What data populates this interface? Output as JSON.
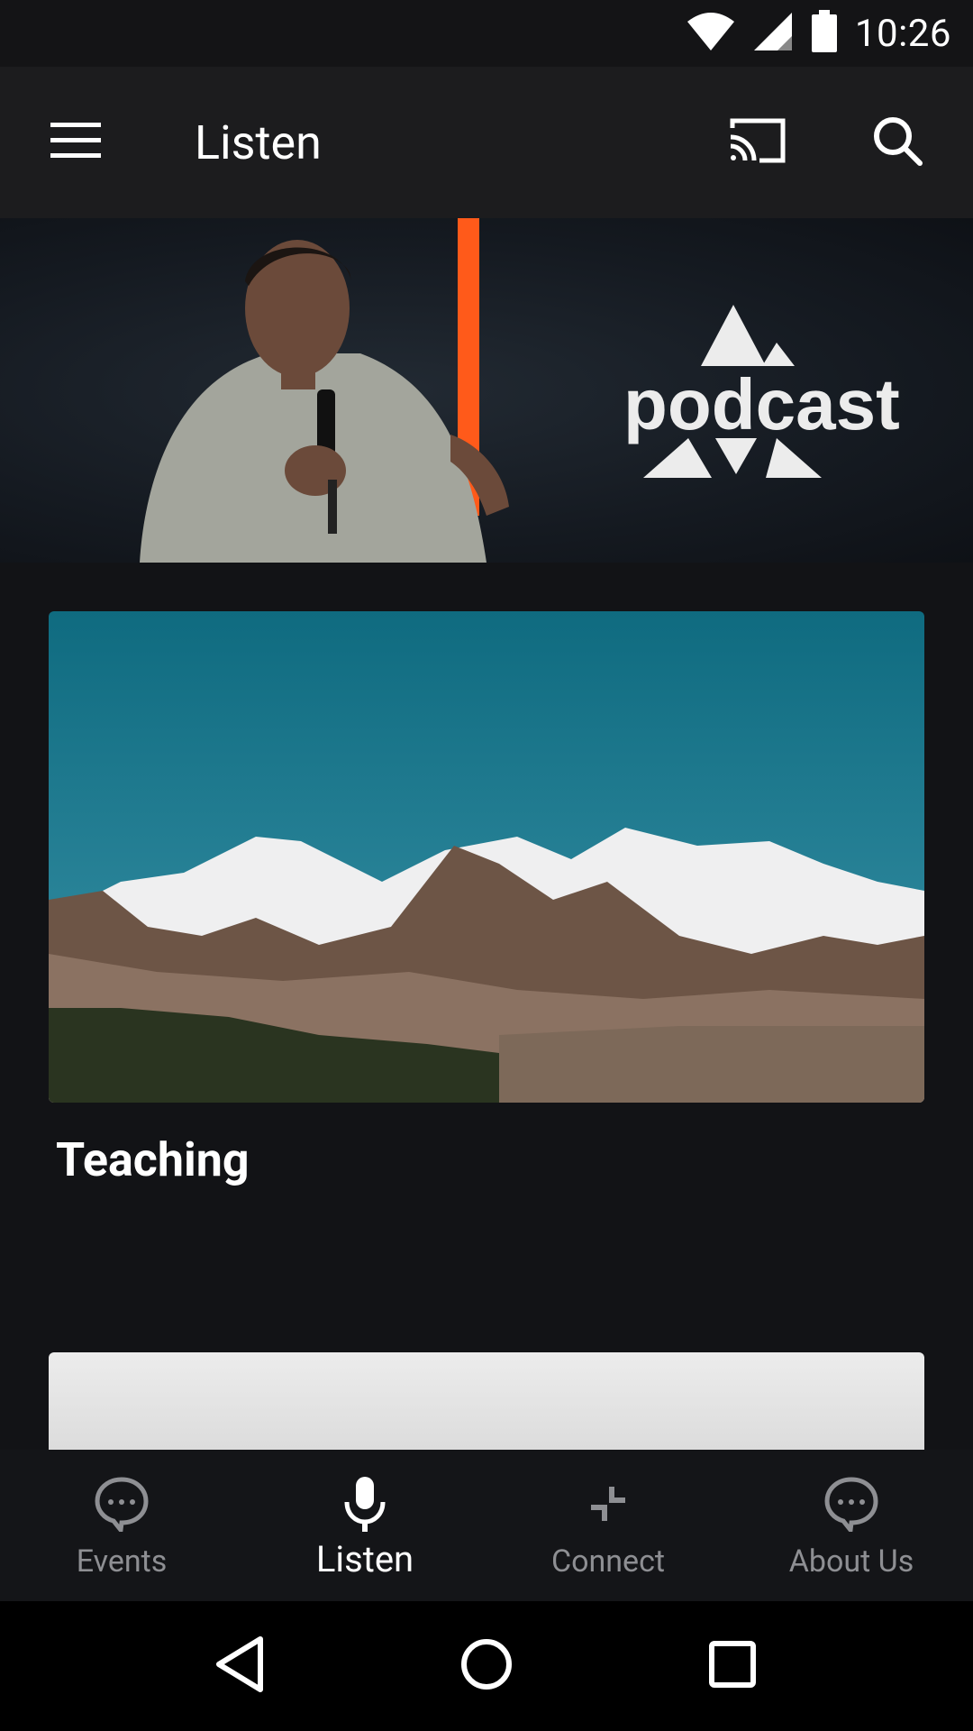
{
  "status_bar": {
    "time": "10:26"
  },
  "app_bar": {
    "title": "Listen"
  },
  "hero": {
    "logo_text": "podcast"
  },
  "cards": [
    {
      "title": "Teaching"
    }
  ],
  "tabs": [
    {
      "label": "Events",
      "icon": "chat-bubble-icon",
      "active": false
    },
    {
      "label": "Listen",
      "icon": "microphone-icon",
      "active": true
    },
    {
      "label": "Connect",
      "icon": "arrows-inward-icon",
      "active": false
    },
    {
      "label": "About Us",
      "icon": "chat-bubble-icon",
      "active": false
    }
  ],
  "colors": {
    "background": "#121316",
    "app_bar": "#1c1c1e",
    "accent_orange": "#ff5a1a",
    "inactive_tab": "#8e8f93"
  }
}
